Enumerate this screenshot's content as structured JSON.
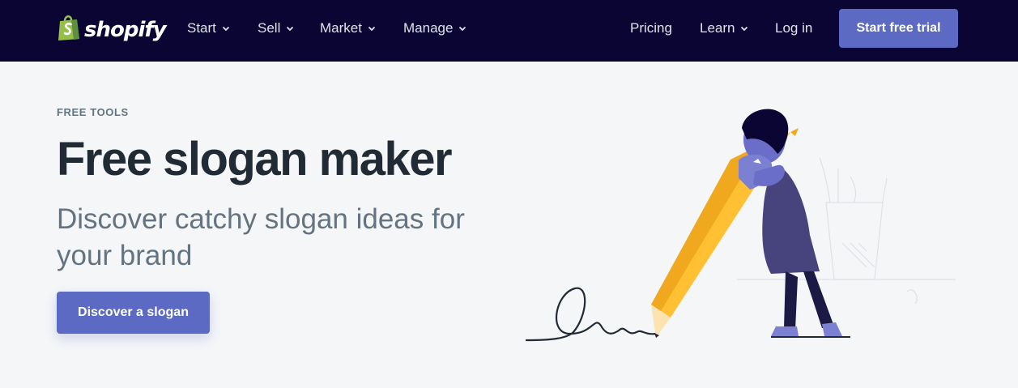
{
  "nav": {
    "logo_text": "shopify",
    "items": [
      {
        "label": "Start"
      },
      {
        "label": "Sell"
      },
      {
        "label": "Market"
      },
      {
        "label": "Manage"
      }
    ],
    "right": {
      "pricing": "Pricing",
      "learn": "Learn",
      "login": "Log in",
      "cta": "Start free trial"
    }
  },
  "hero": {
    "eyebrow": "FREE TOOLS",
    "title": "Free slogan maker",
    "subtitle": "Discover catchy slogan ideas for your brand",
    "cta": "Discover a slogan"
  },
  "colors": {
    "nav_bg": "#0a0533",
    "accent": "#5c6ac4",
    "page_bg": "#f4f6f8",
    "logo_green": "#95bf47",
    "pencil_yellow": "#ffc133"
  },
  "icons": {
    "logo": "shopping-bag-icon",
    "dropdown": "chevron-down-icon"
  }
}
